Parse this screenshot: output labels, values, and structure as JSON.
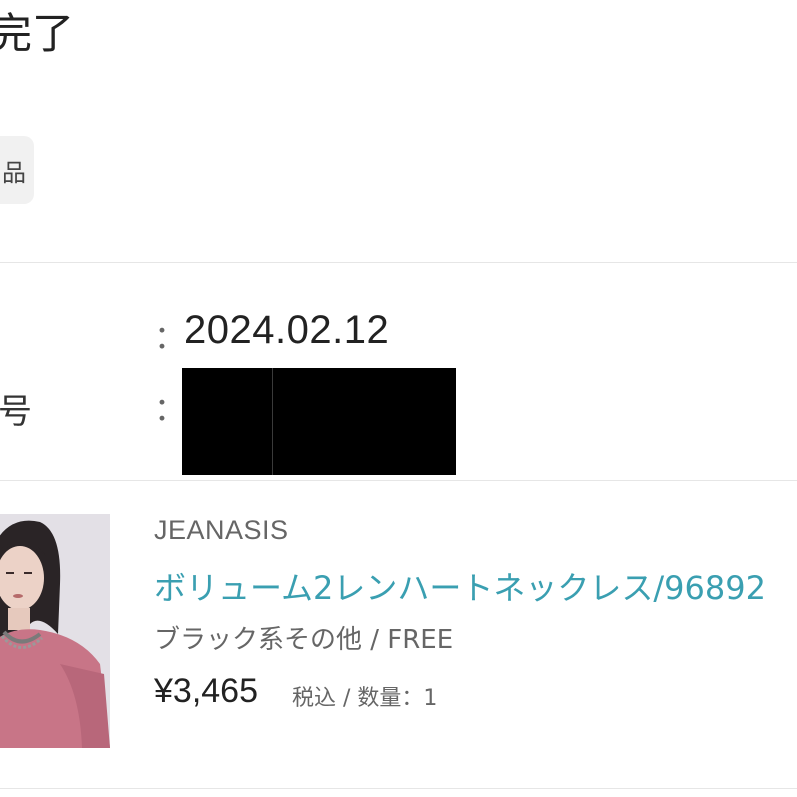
{
  "header": {
    "title": "完了",
    "tag_label": "品"
  },
  "order_info": {
    "order_number_label": "号",
    "colon": "：",
    "order_date": "2024.02.12"
  },
  "product": {
    "brand": "JEANASIS",
    "name": "ボリューム2レンハートネックレス/96892",
    "variant": "ブラック系その他 / FREE",
    "price": "¥3,465",
    "price_meta": "税込 / 数量：1"
  },
  "colors": {
    "link": "#3a9fb1",
    "tag_bg": "#f1f1f1",
    "divider": "#e6e6e6"
  }
}
